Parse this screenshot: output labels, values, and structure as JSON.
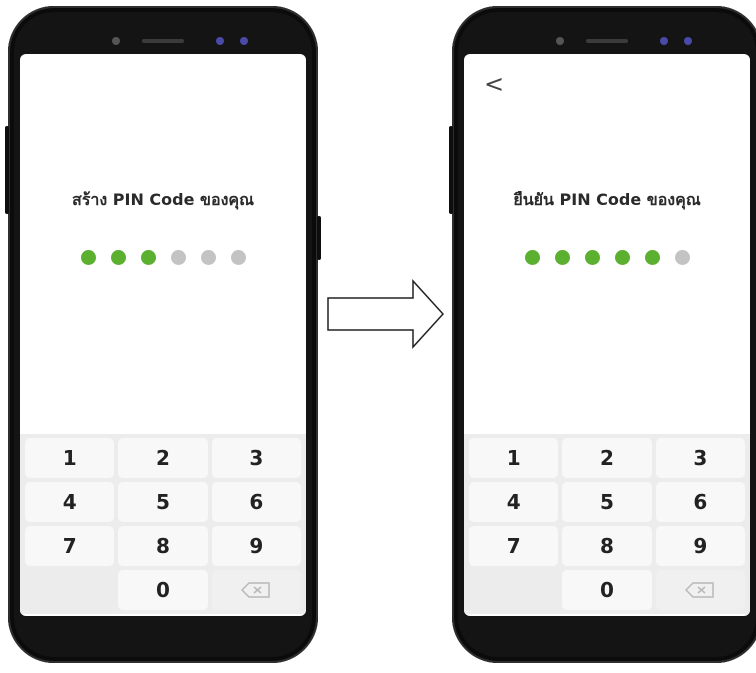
{
  "colors": {
    "accent_green": "#5bb030",
    "empty_dot": "#c3c3c3",
    "phone_body": "#141414",
    "camera_blue": "#6b6bff"
  },
  "screens": [
    {
      "title": "สร้าง PIN Code ของคุณ",
      "has_back_button": false,
      "pin_total": 6,
      "pin_filled": 3,
      "keys": [
        "1",
        "2",
        "3",
        "4",
        "5",
        "6",
        "7",
        "8",
        "9",
        "",
        "0",
        "⌫"
      ]
    },
    {
      "title": "ยืนยัน PIN Code ของคุณ",
      "has_back_button": true,
      "back_icon": "chevron-left-icon",
      "back_label": "<",
      "pin_total": 6,
      "pin_filled": 5,
      "keys": [
        "1",
        "2",
        "3",
        "4",
        "5",
        "6",
        "7",
        "8",
        "9",
        "",
        "0",
        "⌫"
      ]
    }
  ],
  "transition_icon": "right-arrow-icon"
}
